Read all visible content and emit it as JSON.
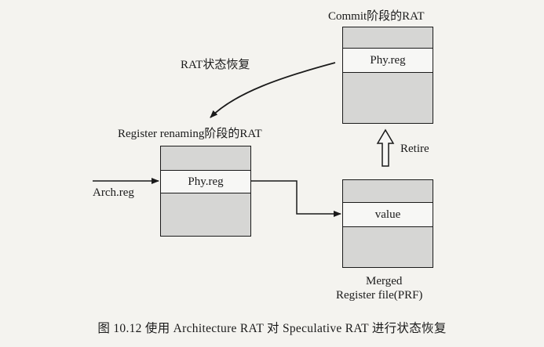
{
  "labels": {
    "commit_title": "Commit阶段的RAT",
    "rat_recovery": "RAT状态恢复",
    "rename_title": "Register renaming阶段的RAT",
    "retire": "Retire",
    "arch_reg": "Arch.reg",
    "merged_line1": "Merged",
    "merged_line2": "Register file(PRF)"
  },
  "boxes": {
    "commit_rat": {
      "row_label": "Phy.reg"
    },
    "rename_rat": {
      "row_label": "Phy.reg"
    },
    "prf": {
      "row_label": "value"
    }
  },
  "caption": "图 10.12   使用 Architecture RAT 对 Speculative RAT 进行状态恢复"
}
